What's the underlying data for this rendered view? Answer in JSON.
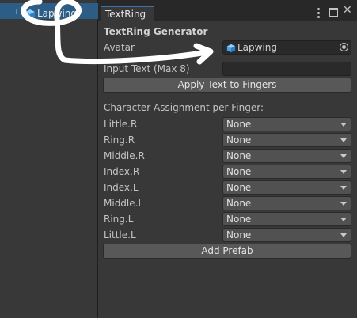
{
  "hierarchy": {
    "selected_item": "Lapwing"
  },
  "window": {
    "tab_title": "TextRing",
    "menu_icon": "kebab-menu-icon",
    "maximize_icon": "maximize-icon",
    "close_icon": "close-icon",
    "close_glyph": "✕"
  },
  "content": {
    "header": "TextRing Generator",
    "avatar_label": "Avatar",
    "avatar_value": "Lapwing",
    "input_text_label": "Input Text (Max 8)",
    "input_text_value": "",
    "apply_button": "Apply Text to Fingers",
    "assignment_header": "Character Assignment per Finger:",
    "fingers": [
      {
        "label": "Little.R",
        "value": "None"
      },
      {
        "label": "Ring.R",
        "value": "None"
      },
      {
        "label": "Middle.R",
        "value": "None"
      },
      {
        "label": "Index.R",
        "value": "None"
      },
      {
        "label": "Index.L",
        "value": "None"
      },
      {
        "label": "Middle.L",
        "value": "None"
      },
      {
        "label": "Ring.L",
        "value": "None"
      },
      {
        "label": "Little.L",
        "value": "None"
      }
    ],
    "add_prefab_button": "Add Prefab"
  },
  "colors": {
    "selection": "#2c5d87",
    "tab_accent": "#3a72b0",
    "annotation_stroke": "#ffffff"
  }
}
